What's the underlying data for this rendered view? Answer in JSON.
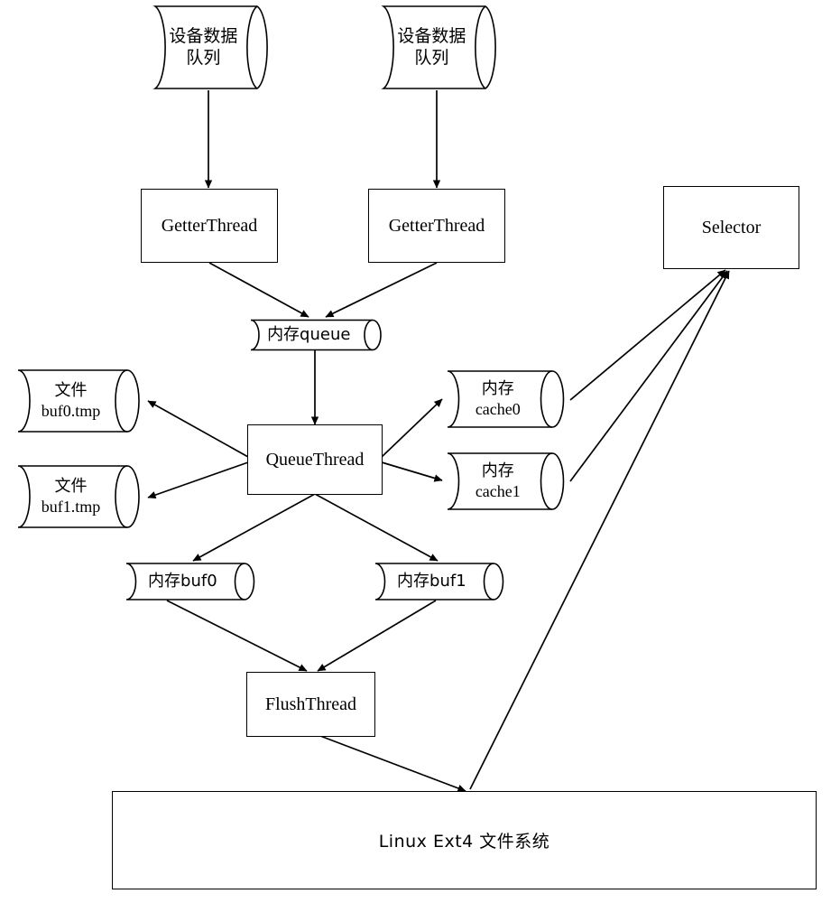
{
  "diagram": {
    "title": "Linux Ext4 file system multi-threaded data buffering flow",
    "bg_color": "#ffffff",
    "line_color": "#000000",
    "nodes": [
      {
        "id": "devq-left",
        "shape": "cylinder",
        "lines": [
          "设备数据",
          "队列"
        ],
        "script": "cn"
      },
      {
        "id": "devq-right",
        "shape": "cylinder",
        "lines": [
          "设备数据",
          "队列"
        ],
        "script": "cn"
      },
      {
        "id": "getter-left",
        "shape": "rect",
        "lines": [
          "GetterThread"
        ],
        "script": "en"
      },
      {
        "id": "getter-right",
        "shape": "rect",
        "lines": [
          "GetterThread"
        ],
        "script": "en"
      },
      {
        "id": "selector",
        "shape": "rect",
        "lines": [
          "Selector"
        ],
        "script": "en"
      },
      {
        "id": "mem-queue",
        "shape": "cylinder",
        "lines": [
          "内存queue"
        ],
        "script": "mixed"
      },
      {
        "id": "file-buf0",
        "shape": "cylinder",
        "lines": [
          "文件",
          "buf0.tmp"
        ],
        "script": "mixed"
      },
      {
        "id": "file-buf1",
        "shape": "cylinder",
        "lines": [
          "文件",
          "buf1.tmp"
        ],
        "script": "mixed"
      },
      {
        "id": "queuethread",
        "shape": "rect",
        "lines": [
          "QueueThread"
        ],
        "script": "en"
      },
      {
        "id": "mem-cache0",
        "shape": "cylinder",
        "lines": [
          "内存",
          "cache0"
        ],
        "script": "mixed"
      },
      {
        "id": "mem-cache1",
        "shape": "cylinder",
        "lines": [
          "内存",
          "cache1"
        ],
        "script": "mixed"
      },
      {
        "id": "mem-buf0",
        "shape": "cylinder",
        "lines": [
          "内存buf0"
        ],
        "script": "mixed"
      },
      {
        "id": "mem-buf1",
        "shape": "cylinder",
        "lines": [
          "内存buf1"
        ],
        "script": "mixed"
      },
      {
        "id": "flushthread",
        "shape": "rect",
        "lines": [
          "FlushThread"
        ],
        "script": "en"
      },
      {
        "id": "filesystem",
        "shape": "rect-wide",
        "lines": [
          "Linux Ext4 文件系统"
        ],
        "script": "mixed"
      }
    ],
    "labels": {
      "device_data_queue_line1": "设备数据",
      "device_data_queue_line2": "队列",
      "getter_thread": "GetterThread",
      "selector": "Selector",
      "memory_queue": "内存queue",
      "file_label": "文件",
      "file_buf0_name": "buf0.tmp",
      "file_buf1_name": "buf1.tmp",
      "queue_thread": "QueueThread",
      "memory_label": "内存",
      "cache0_name": "cache0",
      "cache1_name": "cache1",
      "memory_buf0": "内存buf0",
      "memory_buf1": "内存buf1",
      "flush_thread": "FlushThread",
      "filesystem": "Linux Ext4 文件系统"
    },
    "edges": [
      {
        "from": "devq-left",
        "to": "getter-left",
        "arrow": true
      },
      {
        "from": "devq-right",
        "to": "getter-right",
        "arrow": true
      },
      {
        "from": "getter-left",
        "to": "mem-queue",
        "arrow": true
      },
      {
        "from": "getter-right",
        "to": "mem-queue",
        "arrow": true
      },
      {
        "from": "mem-queue",
        "to": "queuethread",
        "arrow": true
      },
      {
        "from": "queuethread",
        "to": "file-buf0",
        "arrow": true
      },
      {
        "from": "queuethread",
        "to": "file-buf1",
        "arrow": true
      },
      {
        "from": "queuethread",
        "to": "mem-cache0",
        "arrow": true
      },
      {
        "from": "queuethread",
        "to": "mem-cache1",
        "arrow": true
      },
      {
        "from": "queuethread",
        "to": "mem-buf0",
        "arrow": true
      },
      {
        "from": "queuethread",
        "to": "mem-buf1",
        "arrow": true
      },
      {
        "from": "mem-buf0",
        "to": "flushthread",
        "arrow": true
      },
      {
        "from": "mem-buf1",
        "to": "flushthread",
        "arrow": true
      },
      {
        "from": "flushthread",
        "to": "filesystem",
        "arrow": true
      },
      {
        "from": "mem-cache0",
        "to": "selector",
        "arrow": true
      },
      {
        "from": "mem-cache1",
        "to": "selector",
        "arrow": true
      },
      {
        "from": "filesystem",
        "to": "selector",
        "arrow": true
      }
    ]
  }
}
